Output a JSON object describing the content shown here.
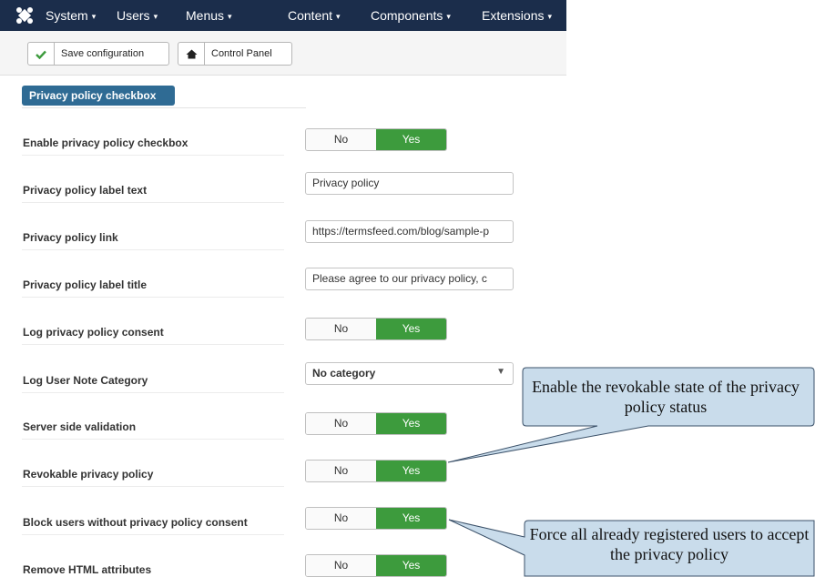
{
  "navbar": {
    "logo_icon": "joomla-icon",
    "items": [
      {
        "label": "System"
      },
      {
        "label": "Users"
      },
      {
        "label": "Menus"
      },
      {
        "label": "Content"
      },
      {
        "label": "Components"
      },
      {
        "label": "Extensions"
      }
    ],
    "caret": "▾"
  },
  "toolbar": {
    "save_label": "Save configuration",
    "save_icon": "check-icon",
    "control_panel_label": "Control Panel",
    "control_panel_icon": "home-icon"
  },
  "section": {
    "tab_label": "Privacy policy checkbox"
  },
  "toggle_labels": {
    "no": "No",
    "yes": "Yes"
  },
  "fields": {
    "enable_checkbox": {
      "label": "Enable privacy policy checkbox",
      "value": "Yes"
    },
    "label_text": {
      "label": "Privacy policy label text",
      "value": "Privacy policy"
    },
    "link": {
      "label": "Privacy policy link",
      "value": "https://termsfeed.com/blog/sample-p"
    },
    "label_title": {
      "label": "Privacy policy label title",
      "value": "Please agree to our privacy policy, c"
    },
    "log_consent": {
      "label": "Log privacy policy consent",
      "value": "Yes"
    },
    "note_category": {
      "label": "Log User Note Category",
      "value": "No category"
    },
    "server_validation": {
      "label": "Server side validation",
      "value": "Yes"
    },
    "revokable": {
      "label": "Revokable privacy policy",
      "value": "Yes"
    },
    "block_users": {
      "label": "Block users without privacy policy consent",
      "value": "Yes"
    },
    "remove_html": {
      "label": "Remove HTML attributes",
      "value": "Yes"
    }
  },
  "callouts": {
    "revokable_note": "Enable the revokable state of the privacy policy status",
    "block_note": "Force all already registered users to accept the privacy policy"
  },
  "colors": {
    "navbar": "#1b2d4b",
    "yes_active": "#3d9b3d",
    "section_tab": "#2f6b94",
    "callout_fill": "#c9dceb"
  }
}
